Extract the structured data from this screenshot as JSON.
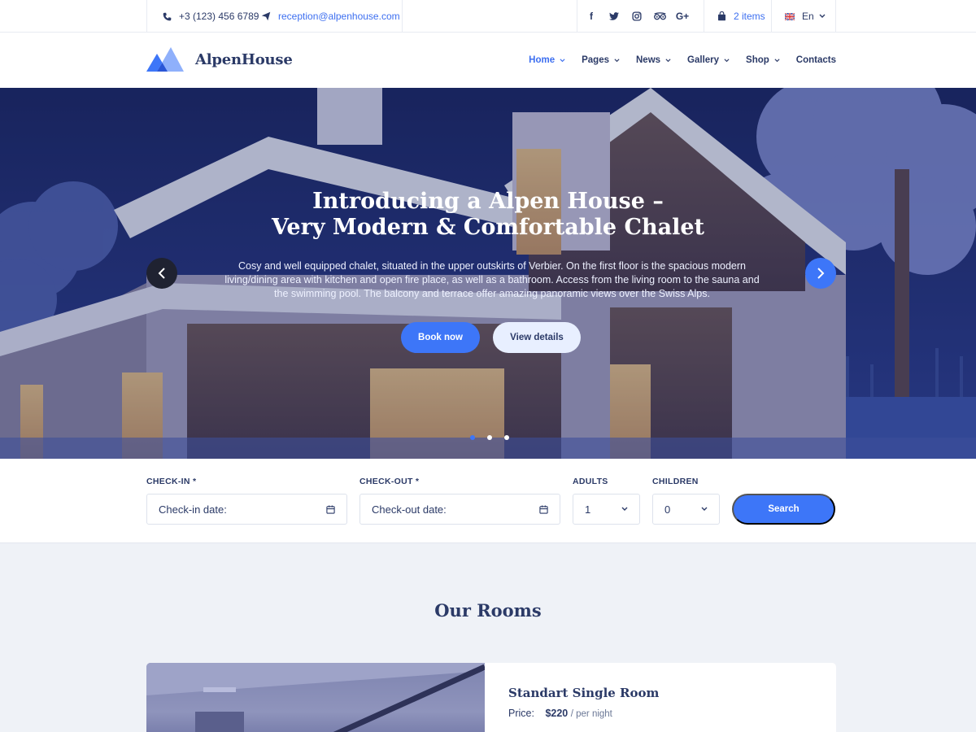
{
  "topbar": {
    "phone": "+3 (123) 456 6789",
    "email": "reception@alpenhouse.com",
    "social_icons": [
      "facebook-icon",
      "twitter-icon",
      "instagram-icon",
      "tripadvisor-icon",
      "google-plus-icon"
    ],
    "social_labels": [
      "f",
      "t",
      "◎",
      "∞",
      "G+"
    ],
    "cart_label": "2 items",
    "language": "En"
  },
  "header": {
    "logo_text": "AlpenHouse",
    "nav": [
      {
        "label": "Home",
        "active": true,
        "dropdown": true
      },
      {
        "label": "Pages",
        "active": false,
        "dropdown": true
      },
      {
        "label": "News",
        "active": false,
        "dropdown": true
      },
      {
        "label": "Gallery",
        "active": false,
        "dropdown": true
      },
      {
        "label": "Shop",
        "active": false,
        "dropdown": true
      },
      {
        "label": "Contacts",
        "active": false,
        "dropdown": false
      }
    ]
  },
  "hero": {
    "title_line1": "Introducing a Alpen House –",
    "title_line2": "Very Modern & Comfortable Chalet",
    "description": "Cosy and well equipped chalet, situated in the upper outskirts of Verbier. On the first floor is the spacious modern living/dining area with kitchen and open fire place, as well as a bathroom. Access from the living room to the sauna and the swimming pool. The balcony and terrace offer amazing panoramic views over the Swiss Alps.",
    "primary_button": "Book now",
    "secondary_button": "View details",
    "slide_count": 3,
    "active_slide": 0
  },
  "booking": {
    "checkin_label": "CHECK-IN *",
    "checkin_placeholder": "Check-in date:",
    "checkout_label": "CHECK-OUT *",
    "checkout_placeholder": "Check-out date:",
    "adults_label": "ADULTS",
    "adults_value": "1",
    "children_label": "CHILDREN",
    "children_value": "0",
    "search_button": "Search"
  },
  "rooms": {
    "title": "Our Rooms",
    "items": [
      {
        "name": "Standart Single Room",
        "price_label": "Price:",
        "price": "$220",
        "period": "/ per night"
      }
    ]
  },
  "colors": {
    "accent": "#3d76f8",
    "text": "#2b3a67",
    "dark_button": "#1f2231",
    "light_button": "#e8efff",
    "section_bg": "#eff2f7"
  }
}
